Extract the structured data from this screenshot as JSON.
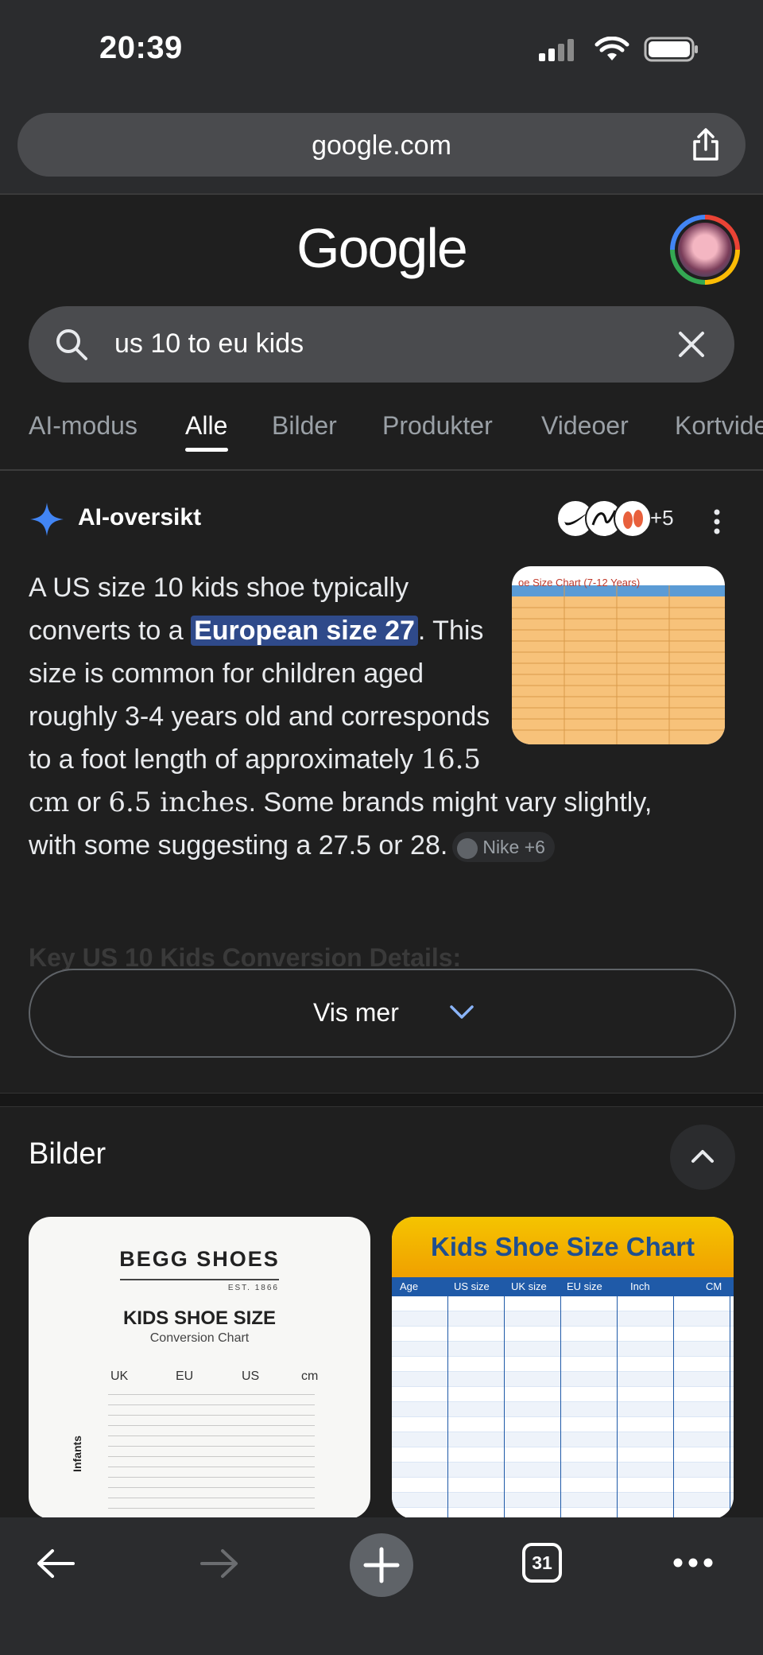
{
  "status_bar": {
    "time": "20:39"
  },
  "browser": {
    "url": "google.com"
  },
  "google": {
    "logo_text": "Google"
  },
  "search": {
    "query": "us 10 to eu kids"
  },
  "tabs": [
    {
      "label": "AI-modus"
    },
    {
      "label": "Alle",
      "active": true
    },
    {
      "label": "Bilder"
    },
    {
      "label": "Produkter"
    },
    {
      "label": "Videoer"
    },
    {
      "label": "Kortvide"
    }
  ],
  "ai_overview": {
    "title": "AI-oversikt",
    "sources_count": "+5",
    "chart_thumb_title": "oe Size Chart (7-12 Years)",
    "text_before": "A US size 10 kids shoe typically converts to a ",
    "highlight": "European size 27",
    "text_after_1": ". This size is common for children aged roughly 3-4 years old and corresponds to a foot length of approximately ",
    "cm": "16.5 cm",
    "or": " or ",
    "inches": "6.5 inches",
    "text_after_2": ". Some brands might vary slightly, with some suggesting a 27.5 or 28.",
    "chip_label": "Nike +6",
    "faded_heading": "Key US 10 Kids Conversion Details:",
    "show_more": "Vis mer"
  },
  "images_section": {
    "title": "Bilder",
    "card1": {
      "brand": "BEGG SHOES",
      "est": "EST. 1866",
      "title": "KIDS SHOE SIZE",
      "subtitle": "Conversion Chart",
      "columns": [
        "UK",
        "EU",
        "US",
        "cm"
      ],
      "side_label": "Infants"
    },
    "card2": {
      "title": "Kids Shoe Size Chart",
      "columns": [
        "Age",
        "US size",
        "UK size",
        "EU size",
        "Inch",
        "CM"
      ]
    }
  },
  "bottom_bar": {
    "tabs_count": "31"
  },
  "colors": {
    "background": "#1f1f1f",
    "highlight_bg": "#2f4a8a",
    "ai_sparkle": "#4285f4"
  }
}
